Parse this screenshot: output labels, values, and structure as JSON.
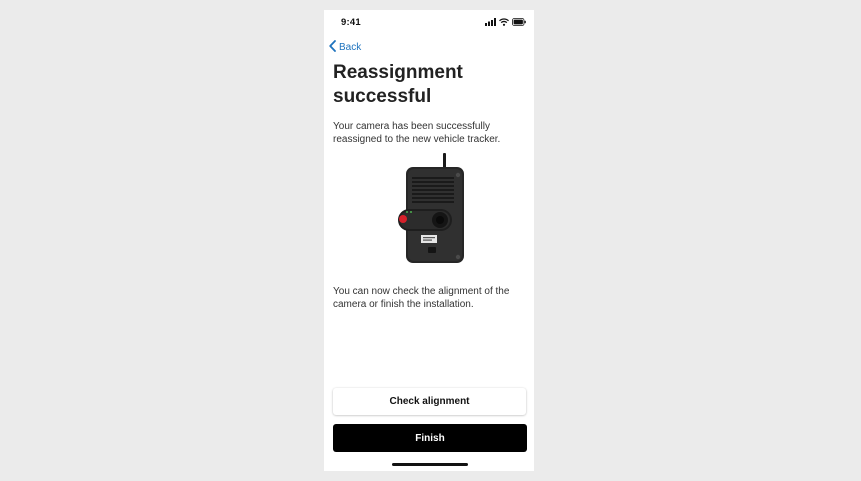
{
  "status_bar": {
    "time": "9:41",
    "icons": [
      "signal-icon",
      "wifi-icon",
      "battery-icon"
    ]
  },
  "nav": {
    "back_label": "Back",
    "back_icon": "chevron-left-icon",
    "accent_color": "#1e73be"
  },
  "main": {
    "title": "Reassignment successful",
    "description": "Your camera has been successfully reassigned to the new vehicle tracker.",
    "image": "dashcam-device-illustration",
    "follow_up": "You can now check the alignment of the camera or finish the installation."
  },
  "actions": {
    "check_alignment_label": "Check alignment",
    "finish_label": "Finish"
  }
}
